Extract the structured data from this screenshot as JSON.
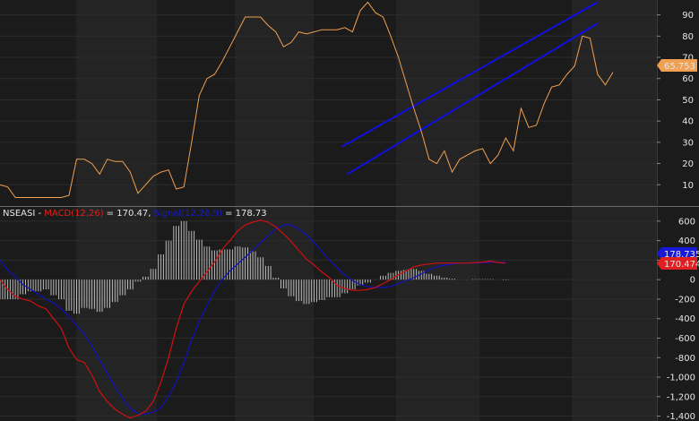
{
  "colors": {
    "rsi": "#f0a050",
    "channel": "#1010e0",
    "macd": "#d01010",
    "signal": "#1010c0",
    "histogram": "#d8d8d8",
    "rsi_badge": "#f0a050",
    "macd_badge": "#e02020",
    "signal_badge": "#1818d8"
  },
  "chart_data": [
    {
      "type": "line",
      "x": [
        0,
        3,
        6,
        9,
        12,
        15,
        18,
        21,
        24,
        27,
        30,
        33,
        36,
        39,
        42,
        45,
        48,
        51,
        54,
        57,
        60,
        63,
        66,
        69,
        72,
        75,
        78,
        81,
        84,
        87,
        90,
        93,
        96,
        99,
        102,
        105,
        108,
        111,
        114,
        117,
        120,
        123,
        126,
        129,
        132,
        135,
        138,
        141,
        144,
        147,
        150,
        153,
        156,
        159,
        162,
        165,
        168,
        171,
        174,
        177,
        180,
        183,
        186,
        189,
        192,
        195,
        198,
        201,
        204,
        207,
        210,
        213,
        216,
        219,
        222,
        225,
        228,
        231,
        234,
        237,
        240
      ],
      "series": [
        {
          "values": [
            10,
            9,
            4,
            4,
            4,
            4,
            4,
            4,
            4,
            5,
            22,
            22,
            20,
            15,
            22,
            21,
            21,
            16,
            6,
            10,
            14,
            16,
            17,
            8,
            9,
            30,
            52,
            60,
            62,
            68,
            75,
            82,
            89,
            89,
            89,
            85,
            82,
            75,
            77,
            82,
            81,
            82,
            83,
            83,
            83,
            84,
            82,
            92,
            96,
            91,
            89,
            80,
            70,
            58,
            46,
            35,
            22,
            20,
            26,
            16,
            22,
            24,
            26,
            27,
            20,
            24,
            32,
            26,
            46,
            37,
            38,
            48,
            56,
            57,
            62,
            66,
            80,
            79,
            62,
            57,
            63
          ]
        },
        {
          "values": [
            null,
            null,
            null,
            null,
            null,
            null,
            null,
            null,
            null,
            null,
            null,
            null,
            null,
            null,
            null,
            null,
            null,
            null,
            null,
            null,
            null,
            null,
            null,
            null,
            null,
            null,
            null,
            null,
            null,
            null,
            null,
            null,
            null,
            null,
            null,
            null,
            null,
            null,
            null,
            null,
            null,
            null,
            null,
            null,
            null,
            null,
            null,
            null,
            null,
            null,
            null,
            null,
            null,
            null,
            null,
            null,
            null,
            null,
            null,
            null,
            null,
            null,
            null,
            null,
            null,
            null,
            null,
            null,
            null,
            null,
            null,
            null,
            null,
            null,
            null,
            null,
            null,
            null,
            null,
            null,
            null
          ]
        },
        {
          "values": [
            null,
            null,
            null,
            null,
            null,
            null,
            null,
            null,
            null,
            null,
            null,
            null,
            null,
            null,
            null,
            null,
            null,
            null,
            null,
            null,
            null,
            null,
            null,
            null,
            null,
            null,
            null,
            null,
            null,
            null,
            null,
            null,
            null,
            null,
            null,
            null,
            null,
            null,
            null,
            null,
            null,
            null,
            null,
            null,
            null,
            null,
            null,
            null,
            null,
            null,
            null,
            null,
            null,
            null,
            null,
            null,
            null,
            null,
            null,
            null,
            null,
            null,
            null,
            null,
            null,
            null,
            null,
            null,
            null,
            null,
            null,
            null,
            null,
            null,
            null,
            null,
            null,
            null,
            null,
            null,
            null
          ]
        }
      ],
      "ylim": [
        0,
        97
      ],
      "yticks": [
        "90",
        "80",
        "70",
        "60",
        "50",
        "40",
        "30",
        "20",
        "10"
      ],
      "last_value_label": "65.753",
      "trend_channel": [
        {
          "x": [
            134,
            234
          ],
          "y": [
            28,
            96
          ]
        },
        {
          "x": [
            136,
            234
          ],
          "y": [
            15,
            86
          ]
        }
      ]
    },
    {
      "type": "line",
      "x": [
        0,
        3,
        6,
        9,
        12,
        15,
        18,
        21,
        24,
        27,
        30,
        33,
        36,
        39,
        42,
        45,
        48,
        51,
        54,
        57,
        60,
        63,
        66,
        69,
        72,
        75,
        78,
        81,
        84,
        87,
        90,
        93,
        96,
        99,
        102,
        105,
        108,
        111,
        114,
        117,
        120,
        123,
        126,
        129,
        132,
        135,
        138,
        141,
        144,
        147,
        150,
        153,
        156,
        159,
        162,
        165,
        168,
        171,
        174,
        177,
        180,
        183,
        186,
        189,
        192,
        195,
        198,
        201,
        204,
        207,
        210,
        213,
        216,
        219,
        222,
        225,
        228,
        231,
        234,
        237,
        240
      ],
      "header": {
        "symbol": "NSEASI",
        "sep": " - ",
        "macd_label": "MACD(12,26)",
        "macd_value": "= 170.47,",
        "signal_label": "Signal(12,26,9)",
        "signal_value": "= 178.73"
      },
      "series": [
        {
          "name": "MACD(12,26)",
          "values": [
            0,
            -100,
            -170,
            -200,
            -220,
            -270,
            -300,
            -400,
            -500,
            -700,
            -820,
            -850,
            -980,
            -1150,
            -1250,
            -1330,
            -1380,
            -1420,
            -1390,
            -1350,
            -1250,
            -1050,
            -800,
            -500,
            -250,
            -120,
            -20,
            80,
            180,
            310,
            400,
            500,
            560,
            590,
            610,
            590,
            540,
            470,
            390,
            300,
            210,
            150,
            80,
            20,
            -60,
            -90,
            -110,
            -110,
            -100,
            -80,
            -40,
            0,
            50,
            90,
            130,
            150,
            160,
            170,
            170,
            170,
            170,
            170,
            175,
            180,
            190,
            175,
            170
          ]
        },
        {
          "name": "Signal(12,26,9)",
          "values": [
            200,
            100,
            30,
            -50,
            -100,
            -150,
            -200,
            -240,
            -300,
            -380,
            -470,
            -560,
            -680,
            -820,
            -960,
            -1100,
            -1220,
            -1320,
            -1370,
            -1380,
            -1360,
            -1310,
            -1200,
            -1050,
            -850,
            -620,
            -430,
            -260,
            -120,
            0,
            90,
            160,
            230,
            300,
            380,
            450,
            520,
            560,
            560,
            520,
            460,
            380,
            290,
            200,
            120,
            50,
            -10,
            -50,
            -70,
            -80,
            -80,
            -70,
            -40,
            -10,
            20,
            60,
            100,
            130,
            150,
            160,
            170,
            170,
            170,
            175,
            178,
            178,
            178
          ]
        },
        {
          "name": "Histogram",
          "values": [
            -200,
            -200,
            -200,
            -150,
            -120,
            -120,
            -100,
            -160,
            -200,
            -320,
            -350,
            -290,
            -300,
            -330,
            -290,
            -230,
            -160,
            -100,
            -20,
            30,
            110,
            260,
            400,
            550,
            600,
            500,
            410,
            340,
            300,
            310,
            310,
            340,
            330,
            290,
            230,
            140,
            20,
            -90,
            -170,
            -220,
            -250,
            -230,
            -210,
            -180,
            -180,
            -140,
            -100,
            -60,
            -30,
            0,
            40,
            70,
            90,
            100,
            110,
            90,
            60,
            40,
            20,
            10,
            0,
            0,
            5,
            5,
            5,
            0,
            -5
          ]
        }
      ],
      "ylim": [
        -1450,
        700
      ],
      "yticks": [
        "600",
        "400",
        "200",
        "0",
        "-200",
        "-400",
        "-600",
        "-800",
        "-1,000",
        "-1,200",
        "-1,400"
      ],
      "signal_badge": "178.735",
      "macd_badge": "170.474"
    }
  ]
}
